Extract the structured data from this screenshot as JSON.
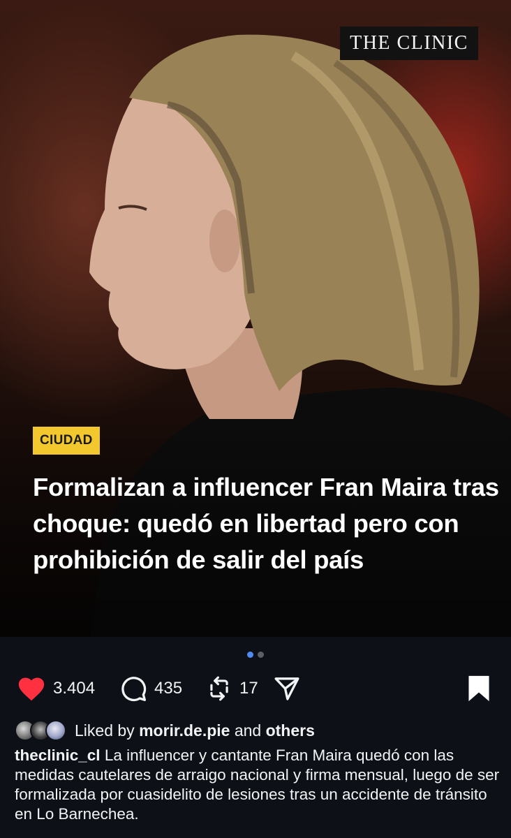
{
  "post": {
    "brand": "THE CLINIC",
    "category": "CIUDAD",
    "headline": "Formalizan a influencer Fran Maira tras choque: quedó en libertad pero con prohibición de salir del país",
    "carousel": {
      "count": 2,
      "active": 1
    }
  },
  "actions": {
    "likes": "3.404",
    "comments": "435",
    "reposts": "17"
  },
  "liked_by": {
    "prefix": "Liked by",
    "user": "morir.de.pie",
    "conjunction": "and",
    "others": "others"
  },
  "caption": {
    "username": "theclinic_cl",
    "text": "La influencer y cantante Fran Maira quedó con las medidas cautelares de arraigo nacional y firma mensual, luego de ser formalizada por cuasidelito de lesiones tras un accidente de tránsito en Lo Barnechea."
  },
  "colors": {
    "like": "#ff3040",
    "badge": "#f2c82e",
    "dot_active": "#4f8bf0",
    "background": "#0d1117"
  },
  "icons": [
    "heart-icon",
    "comment-icon",
    "repost-icon",
    "share-icon",
    "bookmark-icon"
  ]
}
